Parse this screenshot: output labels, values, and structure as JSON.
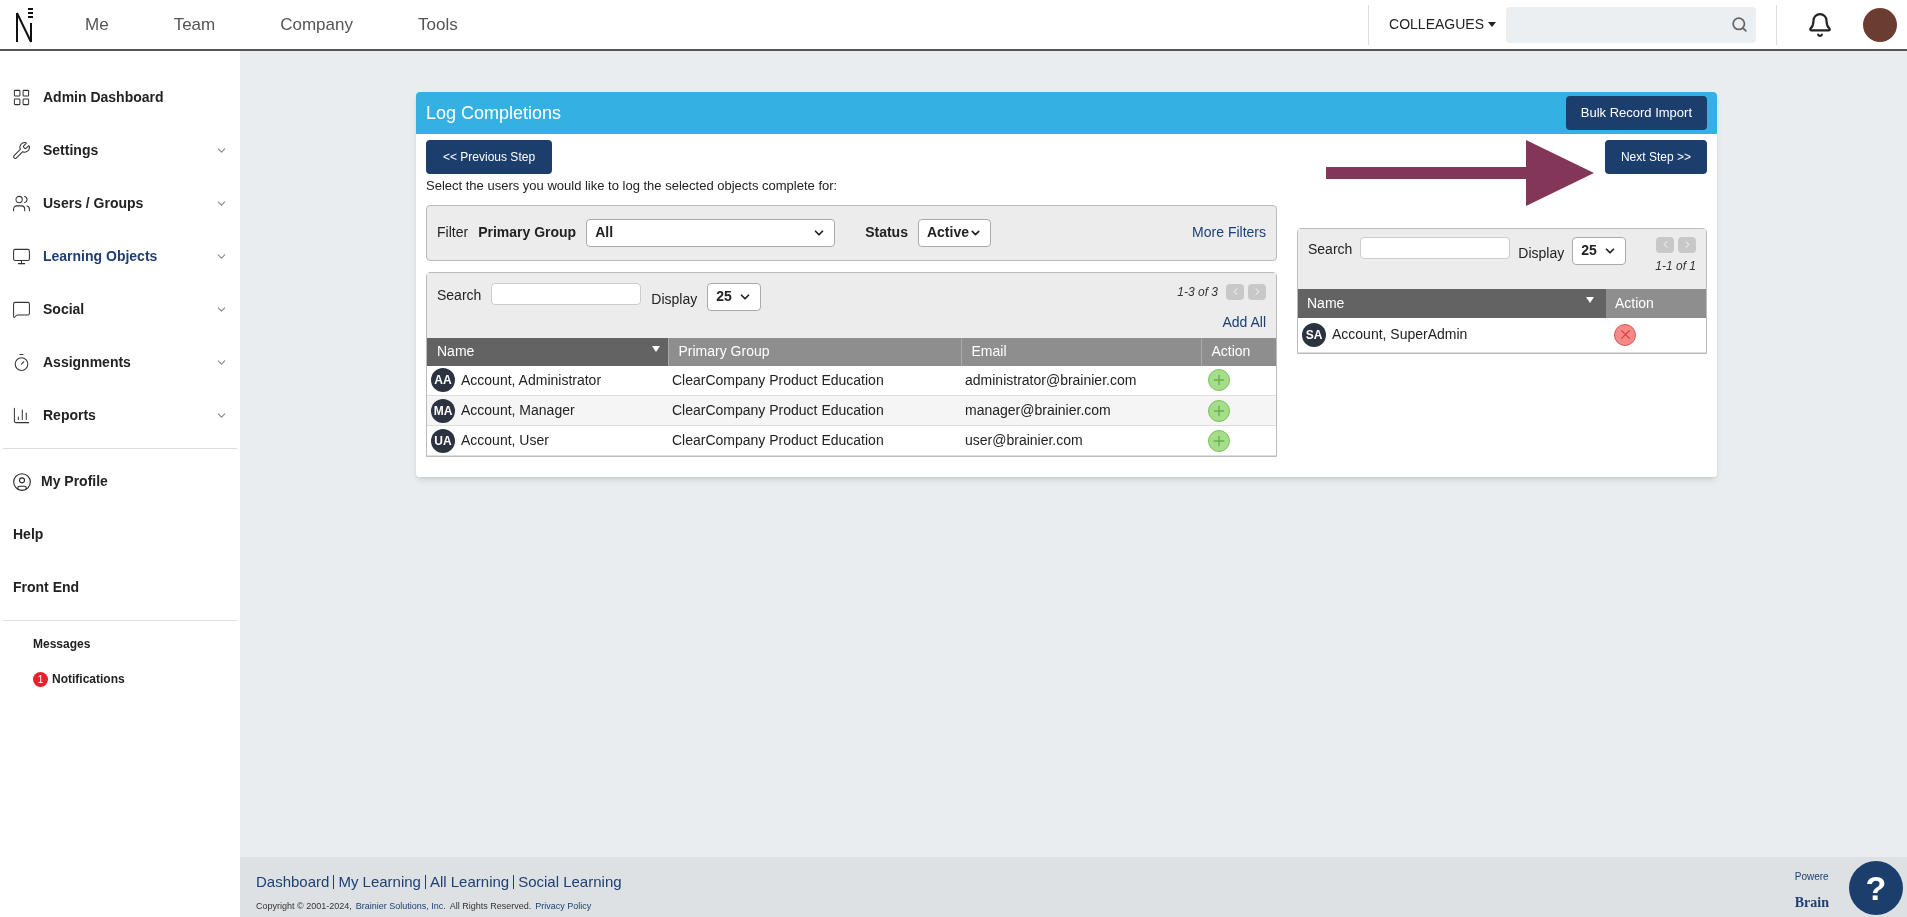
{
  "top_nav": {
    "items": [
      "Me",
      "Team",
      "Company",
      "Tools"
    ],
    "colleagues": "COLLEAGUES"
  },
  "sidebar": {
    "items": [
      {
        "label": "Admin Dashboard",
        "expandable": false,
        "selected": false
      },
      {
        "label": "Settings",
        "expandable": true,
        "selected": false
      },
      {
        "label": "Users / Groups",
        "expandable": true,
        "selected": false
      },
      {
        "label": "Learning Objects",
        "expandable": true,
        "selected": true
      },
      {
        "label": "Social",
        "expandable": true,
        "selected": false
      },
      {
        "label": "Assignments",
        "expandable": true,
        "selected": false
      },
      {
        "label": "Reports",
        "expandable": true,
        "selected": false
      }
    ],
    "profile": "My Profile",
    "links": [
      "Help",
      "Front End"
    ],
    "messages": "Messages",
    "notifications": {
      "label": "Notifications",
      "count": "1"
    }
  },
  "panel": {
    "title": "Log Completions",
    "bulk_button": "Bulk Record Import",
    "prev_button": "<< Previous Step",
    "next_button": "Next Step >>",
    "instructions": "Select the users you would like to log the selected objects complete for:",
    "filter": {
      "label": "Filter",
      "group_label": "Primary Group",
      "group_value": "All",
      "status_label": "Status",
      "status_value": "Active",
      "more": "More Filters"
    },
    "available": {
      "search_label": "Search",
      "display_label": "Display",
      "display_value": "25",
      "range": "1-3 of 3",
      "add_all": "Add All",
      "columns": [
        "Name",
        "Primary Group",
        "Email",
        "Action"
      ],
      "rows": [
        {
          "initials": "AA",
          "name": "Account, Administrator",
          "group": "ClearCompany Product Education",
          "email": "administrator@brainier.com"
        },
        {
          "initials": "MA",
          "name": "Account, Manager",
          "group": "ClearCompany Product Education",
          "email": "manager@brainier.com"
        },
        {
          "initials": "UA",
          "name": "Account, User",
          "group": "ClearCompany Product Education",
          "email": "user@brainier.com"
        }
      ]
    },
    "selected": {
      "search_label": "Search",
      "display_label": "Display",
      "display_value": "25",
      "range": "1-1 of 1",
      "columns": [
        "Name",
        "Action"
      ],
      "rows": [
        {
          "initials": "SA",
          "name": "Account, SuperAdmin"
        }
      ]
    }
  },
  "footer": {
    "links": [
      "Dashboard",
      "My Learning",
      "All Learning",
      "Social Learning"
    ],
    "copyright": "Copyright © 2001-2024,",
    "company": "Brainier Solutions, Inc.",
    "rights": "All Rights Reserved.",
    "privacy": "Privacy Policy",
    "powered": "Powere",
    "brand": "Brain",
    "help": "?"
  }
}
